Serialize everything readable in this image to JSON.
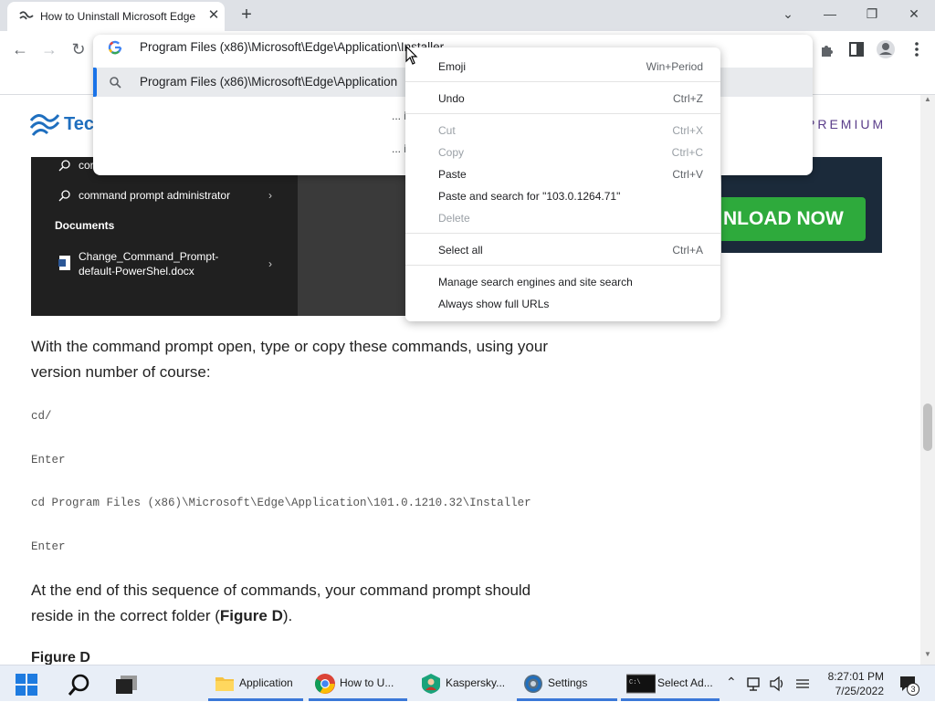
{
  "tab": {
    "title": "How to Uninstall Microsoft Edge",
    "close": "✕",
    "new": "+"
  },
  "window": {
    "chevron": "⌄",
    "minimize": "—",
    "restore": "❐",
    "close": "✕"
  },
  "toolbar": {
    "back": "←",
    "forward": "→",
    "reload": "↻"
  },
  "omnibox": {
    "text": "Program Files (x86)\\Microsoft\\Edge\\Application\\Installer",
    "suggestion": "Program Files (x86)\\Microsoft\\Edge\\Application",
    "dots1": "... i",
    "dots2": "... i"
  },
  "page": {
    "premium": "PREMIUM",
    "search_rows": [
      {
        "text": "cor"
      },
      {
        "text": "command prompt administrator"
      }
    ],
    "documents_heading": "Documents",
    "doc_line1": "Change_Command_Prompt-",
    "doc_line2": "default-PowerShel.docx",
    "ad_button": "NLOAD NOW",
    "para1_line1": "With the command prompt open, type or copy these commands, using your",
    "para1_line2": "version number of course:",
    "code_lines": [
      "cd/",
      "Enter",
      "cd Program Files (x86)\\Microsoft\\Edge\\Application\\101.0.1210.32\\Installer",
      "Enter"
    ],
    "para2_line1": "At the end of this sequence of commands, your command prompt should",
    "para2_line2_pre": "reside in the correct folder (",
    "para2_line2_bold": "Figure D",
    "para2_line2_post": ").",
    "figure_heading": "Figure D"
  },
  "context_menu": {
    "emoji": {
      "label": "Emoji",
      "key": "Win+Period"
    },
    "undo": {
      "label": "Undo",
      "key": "Ctrl+Z"
    },
    "cut": {
      "label": "Cut",
      "key": "Ctrl+X"
    },
    "copy": {
      "label": "Copy",
      "key": "Ctrl+C"
    },
    "paste": {
      "label": "Paste",
      "key": "Ctrl+V"
    },
    "paste_search": {
      "label": "Paste and search for \"103.0.1264.71\""
    },
    "delete": {
      "label": "Delete"
    },
    "select_all": {
      "label": "Select all",
      "key": "Ctrl+A"
    },
    "manage": {
      "label": "Manage search engines and site search"
    },
    "full_urls": {
      "label": "Always show full URLs"
    }
  },
  "taskbar": {
    "apps": [
      {
        "label": "Application"
      },
      {
        "label": "How to U..."
      },
      {
        "label": "Kaspersky..."
      },
      {
        "label": "Settings"
      },
      {
        "label": "Select Ad..."
      }
    ],
    "time": "8:27:01 PM",
    "date": "7/25/2022",
    "notifications": "3"
  },
  "colors": {
    "accent": "#1a73e8",
    "ad_green": "#2eaa3c",
    "premium": "#5a3d8a"
  }
}
